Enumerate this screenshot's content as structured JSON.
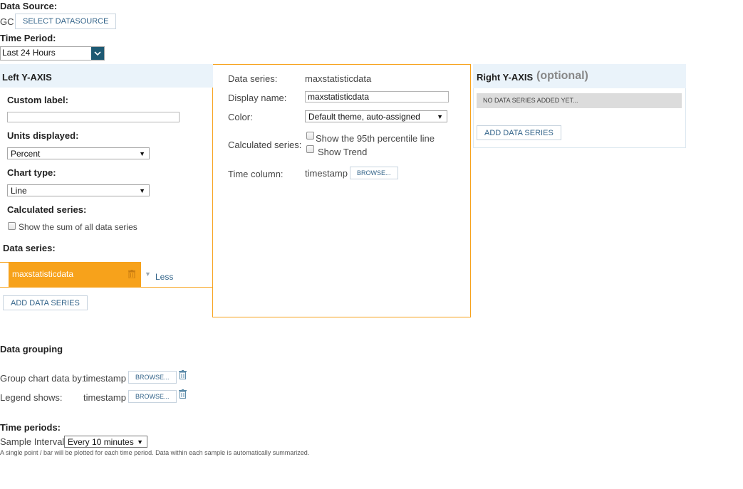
{
  "datasource": {
    "label": "Data Source:",
    "value": "GC",
    "button": "SELECT DATASOURCE"
  },
  "time_period": {
    "label": "Time Period:",
    "selected": "Last 24 Hours"
  },
  "left_axis": {
    "title": "Left Y-AXIS",
    "custom_label": "Custom label:",
    "custom_label_value": "",
    "units_label": "Units displayed:",
    "units_selected": "Percent",
    "chart_type_label": "Chart type:",
    "chart_type_selected": "Line",
    "calc_label": "Calculated series:",
    "sum_checkbox": "Show the sum of all data series",
    "data_series_label": "Data series:",
    "series": [
      {
        "name": "maxstatisticdata"
      }
    ],
    "less_link": "Less",
    "add_button": "ADD DATA SERIES"
  },
  "series_detail": {
    "data_series_label": "Data series:",
    "data_series_value": "maxstatisticdata",
    "display_name_label": "Display name:",
    "display_name_value": "maxstatisticdata",
    "color_label": "Color:",
    "color_selected": "Default theme, auto-assigned",
    "calc_label": "Calculated series:",
    "percentile_checkbox": "Show the 95th percentile line",
    "trend_checkbox": "Show Trend",
    "time_column_label": "Time column:",
    "time_column_value": "timestamp",
    "browse": "BROWSE..."
  },
  "right_axis": {
    "title": "Right Y-AXIS",
    "optional": "(optional)",
    "empty_message": "NO DATA SERIES ADDED YET...",
    "add_button": "ADD DATA SERIES"
  },
  "grouping": {
    "title": "Data grouping",
    "group_by_label": "Group chart data by:",
    "group_by_value": "timestamp",
    "legend_label": "Legend shows:",
    "legend_value": "timestamp",
    "browse": "BROWSE..."
  },
  "time_periods": {
    "title": "Time periods:",
    "sample_label": "Sample Interval:",
    "sample_selected": "Every 10 minutes",
    "note": "A single point / bar will be plotted for each time period. Data within each sample is automatically summarized."
  },
  "colors": {
    "accent_orange": "#f7a21b",
    "panel_blue": "#eaf3fa",
    "link_blue": "#33648a",
    "select_teal": "#1e5a73"
  }
}
